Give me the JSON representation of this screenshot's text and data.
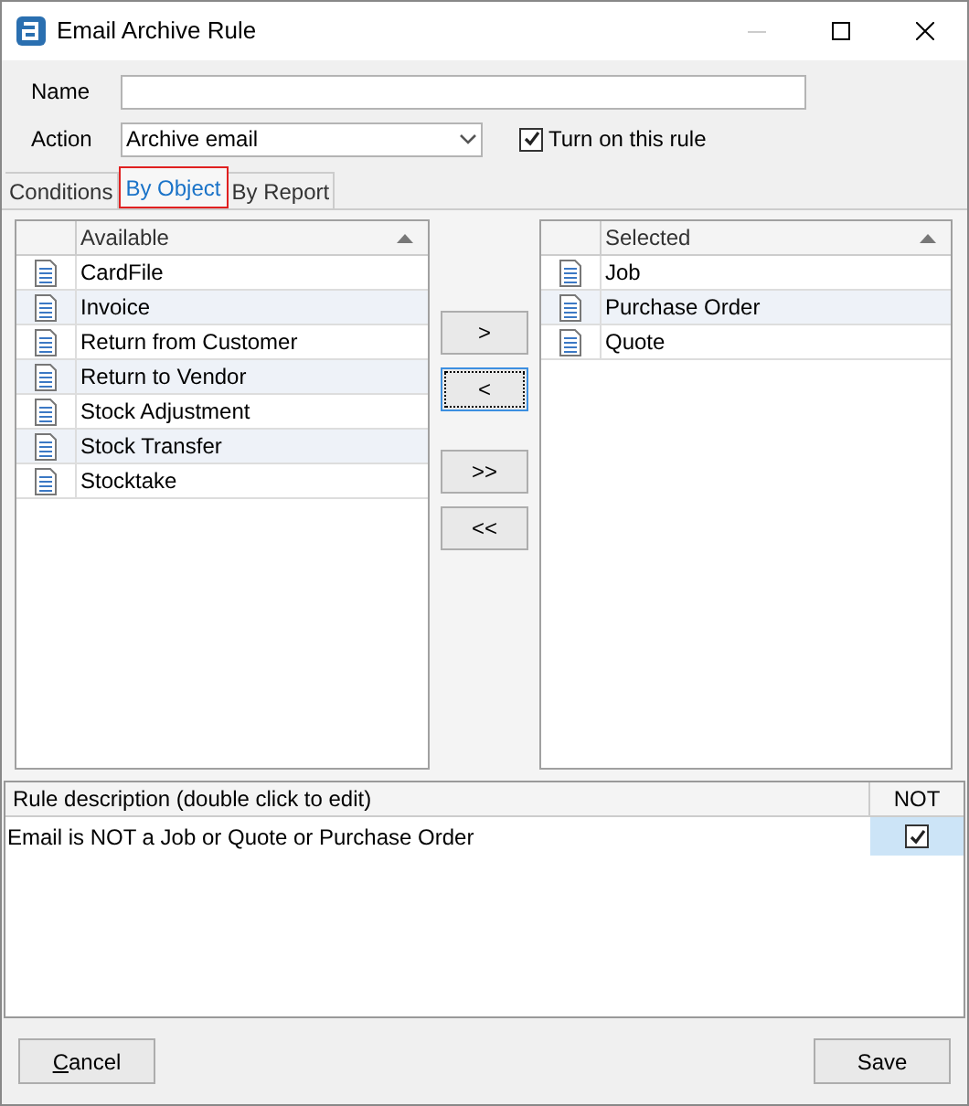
{
  "window": {
    "title": "Email Archive Rule"
  },
  "name_field": {
    "label": "Name"
  },
  "action_field": {
    "label": "Action",
    "value": "Archive email"
  },
  "turn_on": {
    "label": "Turn on this rule",
    "checked": true
  },
  "tabs": [
    {
      "label": "Conditions",
      "selected": false
    },
    {
      "label": "By Object",
      "selected": true
    },
    {
      "label": "By Report",
      "selected": false
    }
  ],
  "available": {
    "heading": "Available",
    "rows": [
      {
        "label": "CardFile"
      },
      {
        "label": "Invoice"
      },
      {
        "label": "Return from Customer"
      },
      {
        "label": "Return to Vendor"
      },
      {
        "label": "Stock Adjustment"
      },
      {
        "label": "Stock Transfer"
      },
      {
        "label": "Stocktake"
      }
    ]
  },
  "move_buttons": [
    {
      "label": ">",
      "focused": false
    },
    {
      "label": "<",
      "focused": true
    },
    {
      "label": ">>",
      "focused": false
    },
    {
      "label": "<<",
      "focused": false
    }
  ],
  "selected": {
    "heading": "Selected",
    "rows": [
      {
        "label": "Job"
      },
      {
        "label": "Purchase Order"
      },
      {
        "label": "Quote"
      }
    ]
  },
  "rules": {
    "columns": [
      "Rule description (double click to edit)",
      "NOT"
    ],
    "rows": [
      {
        "description": "Email is NOT a Job or Quote or Purchase Order",
        "not": true
      }
    ]
  },
  "buttons": {
    "cancel": "Cancel",
    "save": "Save"
  }
}
